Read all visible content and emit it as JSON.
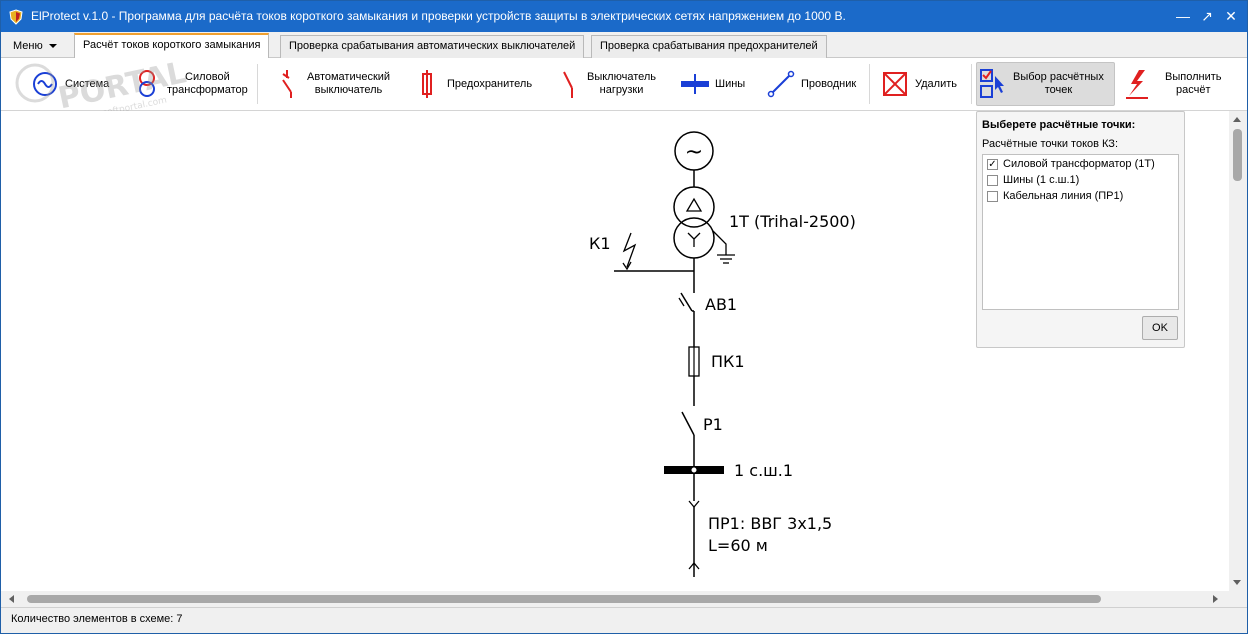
{
  "window": {
    "title": "ElProtect v.1.0 - Программа для расчёта токов короткого замыкания и проверки устройств защиты в электрических сетях напряжением до 1000 В.",
    "controls": {
      "minimize": "—",
      "maximize": "↗",
      "close": "✕"
    }
  },
  "menu": {
    "label": "Меню"
  },
  "tabs": [
    {
      "label": "Расчёт токов короткого замыкания",
      "active": true
    },
    {
      "label": "Проверка срабатывания автоматических выключателей",
      "active": false
    },
    {
      "label": "Проверка срабатывания предохранителей",
      "active": false
    }
  ],
  "ribbon": {
    "system": "Система",
    "transformer": "Силовой\nтрансформатор",
    "breaker": "Автоматический\nвыключатель",
    "fuse": "Предохранитель",
    "load_switch": "Выключатель\nнагрузки",
    "busbars": "Шины",
    "conductor": "Проводник",
    "delete": "Удалить",
    "select_points": "Выбор расчётных\nточек",
    "run": "Выполнить\nрасчёт"
  },
  "watermark": {
    "text": "PORTAL",
    "url": "www.softportal.com"
  },
  "panel": {
    "title": "Выберете расчётные точки:",
    "subtitle": "Расчётные точки токов КЗ:",
    "items": [
      {
        "label": "Силовой трансформатор (1Т)",
        "checked": true
      },
      {
        "label": "Шины (1 с.ш.1)",
        "checked": false
      },
      {
        "label": "Кабельная линия (ПР1)",
        "checked": false
      }
    ],
    "ok": "OK"
  },
  "diagram": {
    "source_symbol": "~",
    "transformer_label": "1Т (Trihal-2500)",
    "fault_label": "К1",
    "breaker_label": "АВ1",
    "fuse_label": "ПК1",
    "switch_label": "Р1",
    "bus_label": "1 с.ш.1",
    "cable_label_line1": "ПР1: ВВГ 3х1,5",
    "cable_label_line2": "L=60 м"
  },
  "status": {
    "text": "Количество элементов в схеме: 7"
  },
  "colors": {
    "titlebar": "#1b6ac9",
    "accent_tab": "#f0a030",
    "icon_red": "#e02020",
    "icon_blue": "#1a3fd6"
  }
}
